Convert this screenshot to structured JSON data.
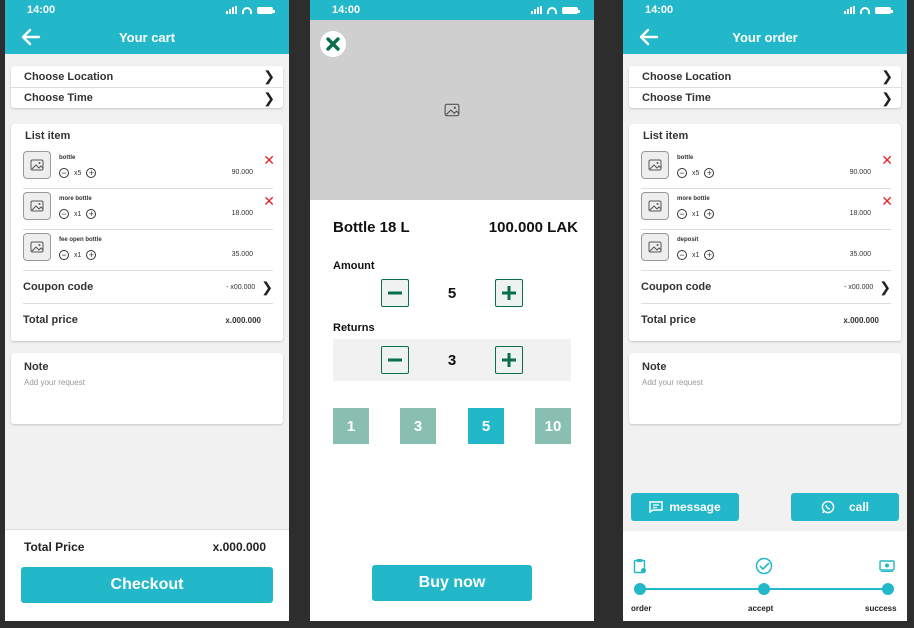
{
  "status": {
    "time": "14:00"
  },
  "cart": {
    "title": "Your cart",
    "choose_location": "Choose Location",
    "choose_time": "Choose Time",
    "list_title": "List item",
    "items": [
      {
        "name": "bottle",
        "qty": "x5",
        "price": "90.000"
      },
      {
        "name": "more bottle",
        "qty": "x1",
        "price": "18.000"
      },
      {
        "name": "fee open bottle",
        "qty": "x1",
        "price": "35.000"
      }
    ],
    "coupon_label": "Coupon code",
    "coupon_value": "- x00.000",
    "total_label": "Total price",
    "total_value": "x.000.000",
    "note_title": "Note",
    "note_placeholder": "Add your request",
    "footer_total_label": "Total Price",
    "footer_total_value": "x.000.000",
    "checkout_label": "Checkout"
  },
  "product": {
    "name": "Bottle 18 L",
    "price": "100.000 LAK",
    "amount_label": "Amount",
    "amount_value": "5",
    "returns_label": "Returns",
    "returns_value": "3",
    "quick_options": [
      "1",
      "3",
      "5",
      "10"
    ],
    "buy_label": "Buy  now"
  },
  "order": {
    "title": "Your order",
    "choose_location": "Choose Location",
    "choose_time": "Choose Time",
    "list_title": "List item",
    "items": [
      {
        "name": "bottle",
        "qty": "x5",
        "price": "90.000"
      },
      {
        "name": "more bottle",
        "qty": "x1",
        "price": "18.000"
      },
      {
        "name": "deposit",
        "qty": "x1",
        "price": "35.000"
      }
    ],
    "coupon_label": "Coupon code",
    "coupon_value": "- x00.000",
    "total_label": "Total price",
    "total_value": "x.000.000",
    "note_title": "Note",
    "note_placeholder": "Add your request",
    "message_label": "message",
    "call_label": "call",
    "steps": [
      "order",
      "accept",
      "success"
    ]
  },
  "colors": {
    "accent": "#22b7c9",
    "delete": "#e0222c",
    "stepper_icon": "#0a6e4a",
    "quick_inactive": "#88bfb0",
    "quick_active": "#22b7c9"
  }
}
